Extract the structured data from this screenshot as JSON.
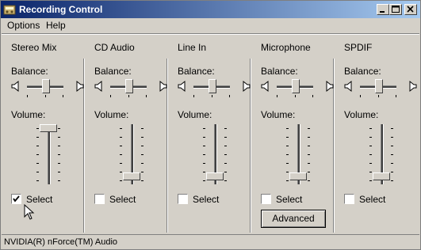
{
  "window": {
    "title": "Recording Control"
  },
  "menu": [
    "Options",
    "Help"
  ],
  "columns": [
    {
      "name": "Stereo Mix",
      "balance_label": "Balance:",
      "volume_label": "Volume:",
      "volume_level": 1.0,
      "select_label": "Select",
      "selected": true
    },
    {
      "name": "CD Audio",
      "balance_label": "Balance:",
      "volume_label": "Volume:",
      "volume_level": 0.0,
      "select_label": "Select",
      "selected": false
    },
    {
      "name": "Line In",
      "balance_label": "Balance:",
      "volume_label": "Volume:",
      "volume_level": 0.0,
      "select_label": "Select",
      "selected": false
    },
    {
      "name": "Microphone",
      "balance_label": "Balance:",
      "volume_label": "Volume:",
      "volume_level": 0.0,
      "select_label": "Select",
      "selected": false,
      "advanced_label": "Advanced"
    },
    {
      "name": "SPDIF",
      "balance_label": "Balance:",
      "volume_label": "Volume:",
      "volume_level": 0.0,
      "select_label": "Select",
      "selected": false
    }
  ],
  "status": {
    "text": "NVIDIA(R) nForce(TM) Audio"
  }
}
